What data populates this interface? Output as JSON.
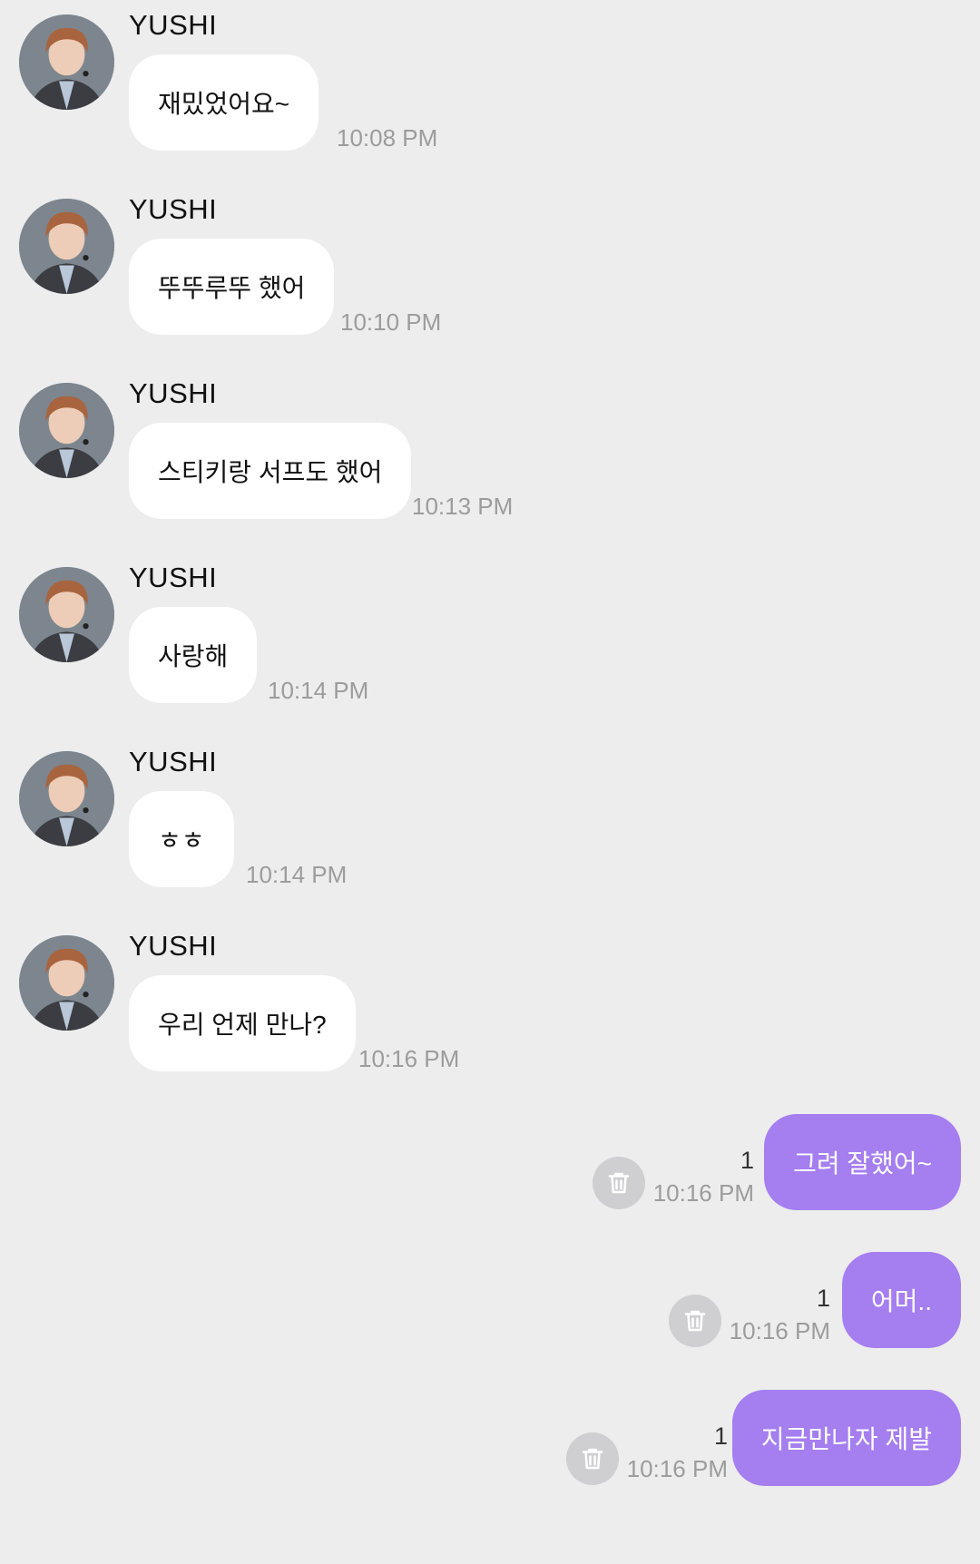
{
  "incoming": [
    {
      "sender": "YUSHI",
      "text": "재밌었어요~",
      "time": "10:08 PM"
    },
    {
      "sender": "YUSHI",
      "text": "뚜뚜루뚜 했어",
      "time": "10:10 PM"
    },
    {
      "sender": "YUSHI",
      "text": "스티키랑 서프도 했어",
      "time": "10:13 PM"
    },
    {
      "sender": "YUSHI",
      "text": "사랑해",
      "time": "10:14 PM"
    },
    {
      "sender": "YUSHI",
      "text": "ㅎㅎ",
      "time": "10:14 PM"
    },
    {
      "sender": "YUSHI",
      "text": "우리 언제 만나?",
      "time": "10:16 PM"
    }
  ],
  "outgoing": [
    {
      "text": "그려 잘했어~",
      "time": "10:16 PM",
      "unread": "1",
      "icon": "trash-icon"
    },
    {
      "text": "어머..",
      "time": "10:16 PM",
      "unread": "1",
      "icon": "trash-icon"
    },
    {
      "text": "지금만나자 제발",
      "time": "10:16 PM",
      "unread": "1",
      "icon": "trash-icon"
    }
  ],
  "colors": {
    "background": "#ededee",
    "incoming_bubble": "#ffffff",
    "outgoing_bubble": "#a57ef0",
    "timestamp": "#9c9c9c"
  }
}
